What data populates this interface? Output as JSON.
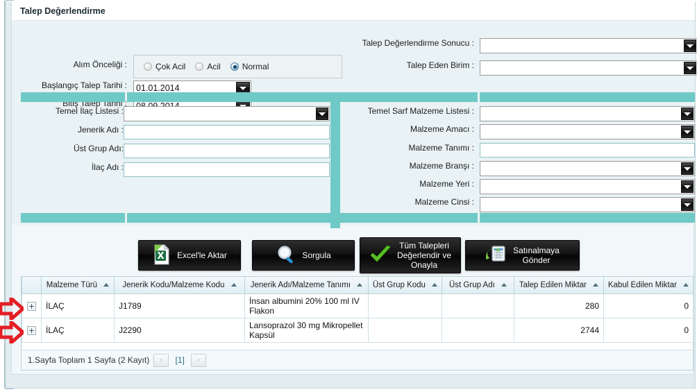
{
  "window": {
    "title": "Talep Değerlendirme"
  },
  "colors": {
    "panel_header_teal": "#6fc9c6",
    "form_background": "#e9f2f4",
    "frame_border": "#a9c4cc",
    "annotation_red": "#e31e24",
    "grid_header": "#e0eef3"
  },
  "form": {
    "priority": {
      "label": "Alım Önceliği :",
      "options": [
        {
          "label": "Çok Acil",
          "checked": false
        },
        {
          "label": "Acil",
          "checked": false
        },
        {
          "label": "Normal",
          "checked": true
        }
      ]
    },
    "start_date": {
      "label": "Başlangıç Talep Tarihi :",
      "value": "01.01.2014"
    },
    "end_date": {
      "label": "Bitiş Talep Tarihi :",
      "value": "08.09.2014"
    },
    "result": {
      "label": "Talep Değerlendirme Sonucu :",
      "value": ""
    },
    "requesting_unit": {
      "label": "Talep Eden Birim :",
      "value": ""
    },
    "drug_section": {
      "basic_drug_list": {
        "label": "Temel İlaç Listesi :",
        "value": ""
      },
      "generic_name": {
        "label": "Jenerik Adı :",
        "value": ""
      },
      "parent_group_name": {
        "label": "Üst Grup Adı:",
        "value": ""
      },
      "drug_name": {
        "label": "İlaç Adı :",
        "value": ""
      }
    },
    "material_section": {
      "basic_consumable_list": {
        "label": "Temel Sarf Malzeme Listesi :",
        "value": ""
      },
      "material_purpose": {
        "label": "Malzeme Amacı :",
        "value": ""
      },
      "material_definition": {
        "label": "Malzeme Tanımı :",
        "value": ""
      },
      "material_branch": {
        "label": "Malzeme Branşı :",
        "value": ""
      },
      "material_place": {
        "label": "Malzeme Yeri :",
        "value": ""
      },
      "material_kind": {
        "label": "Malzeme Cinsi :",
        "value": ""
      }
    }
  },
  "buttons": [
    {
      "label": "Excel'le Aktar",
      "icon": "excel-icon"
    },
    {
      "label": "Sorgula",
      "icon": "magnifier-icon"
    },
    {
      "label": "Tüm Talepleri\nDeğerlendir ve\nOnayla",
      "icon": "green-check-icon"
    },
    {
      "label": "Satınalmaya\nGönder",
      "icon": "send-to-purchase-icon"
    }
  ],
  "grid": {
    "columns": [
      {
        "label": "",
        "sort": false
      },
      {
        "label": "Malzeme Türü",
        "sort": true
      },
      {
        "label": "Jenerik Kodu/Malzeme Kodu",
        "sort": true
      },
      {
        "label": "Jenerik Adı/Malzeme Tanımı",
        "sort": true
      },
      {
        "label": "Üst Grup Kodu",
        "sort": true
      },
      {
        "label": "Üst Grup Adı",
        "sort": true
      },
      {
        "label": "Talep Edilen Miktar",
        "sort": true
      },
      {
        "label": "Kabul Edilen Miktar",
        "sort": true
      }
    ],
    "expand_glyph": "+",
    "rows": [
      {
        "material_type": "İLAÇ",
        "code": "J1789",
        "name": "İnsan albumini 20% 100 ml IV Flakon",
        "parent_group_code": "",
        "parent_group_name": "",
        "requested_qty": "280",
        "accepted_qty": "0"
      },
      {
        "material_type": "İLAÇ",
        "code": "J2290",
        "name": "Lansoprazol 30 mg Mikropellet Kapsül",
        "parent_group_code": "",
        "parent_group_name": "",
        "requested_qty": "2744",
        "accepted_qty": "0"
      }
    ],
    "pager": {
      "summary": "1.Sayfa Toplam 1 Sayfa (2 Kayıt)",
      "prev": "‹",
      "current": "[1]",
      "next": "›"
    }
  }
}
